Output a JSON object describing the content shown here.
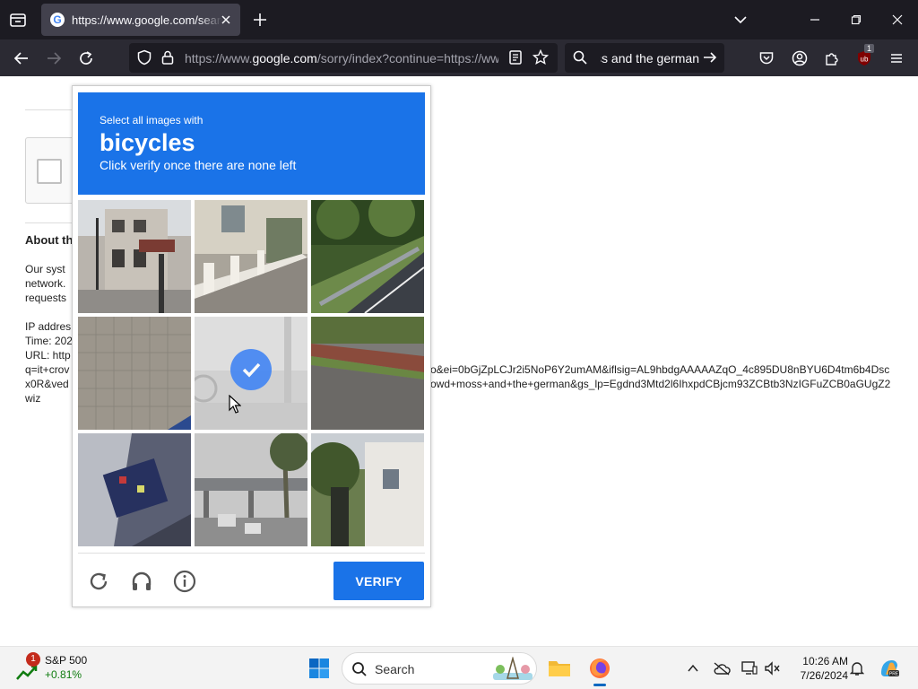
{
  "browser": {
    "tab": {
      "title": "https://www.google.com/search?q=it+crowd+moss+and+the+german",
      "favicon_letter": "G"
    },
    "url": {
      "prefix": "https://www.",
      "domain": "google.com",
      "path": "/sorry/index?continue=https://www.google.com/search"
    },
    "search_text": "it crowd moss and the german",
    "extension_badge": "1"
  },
  "page": {
    "about_heading": "About th",
    "para_lines": [
      "Our syst",
      "network.",
      "requests"
    ],
    "ip_line": "IP addres",
    "time_line": "Time: 202",
    "url_line": "URL: http",
    "url_line2": "q=it+crov",
    "url_line3": "x0R&ved",
    "url_line4": "wiz",
    "url_right1": "o&ei=0bGjZpLCJr2i5NoP6Y2umAM&iflsig=AL9hbdgAAAAAZqO_4c895DU8nBYU6D4tm6b4Dsc",
    "url_right2": "owd+moss+and+the+german&gs_lp=Egdnd3Mtd2l6IhxpdCBjcm93ZCBtb3NzIGFuZCB0aGUgZ2"
  },
  "captcha": {
    "instruction_small": "Select all images with",
    "target": "bicycles",
    "instruction_sub": "Click verify once there are none left",
    "verify_label": "VERIFY",
    "tiles": [
      {
        "scene": "building-crosswalk",
        "selected": false
      },
      {
        "scene": "white-railing-street",
        "selected": false
      },
      {
        "scene": "road-guardrail-trees",
        "selected": false
      },
      {
        "scene": "cobblestone-pavement",
        "selected": false
      },
      {
        "scene": "grey-street-partial-wheel",
        "selected": true
      },
      {
        "scene": "road-with-wall",
        "selected": false
      },
      {
        "scene": "closeup-vehicle-parts",
        "selected": false
      },
      {
        "scene": "street-overpass-palm",
        "selected": false
      },
      {
        "scene": "house-tree",
        "selected": false
      }
    ]
  },
  "taskbar": {
    "widget_name": "S&P 500",
    "widget_value": "+0.81%",
    "widget_badge": "1",
    "search_label": "Search",
    "time": "10:26 AM",
    "date": "7/26/2024"
  },
  "colors": {
    "captcha_blue": "#1a73e8",
    "check_blue": "#4285f4",
    "browser_dark": "#1c1b22",
    "toolbar": "#2b2a33"
  }
}
